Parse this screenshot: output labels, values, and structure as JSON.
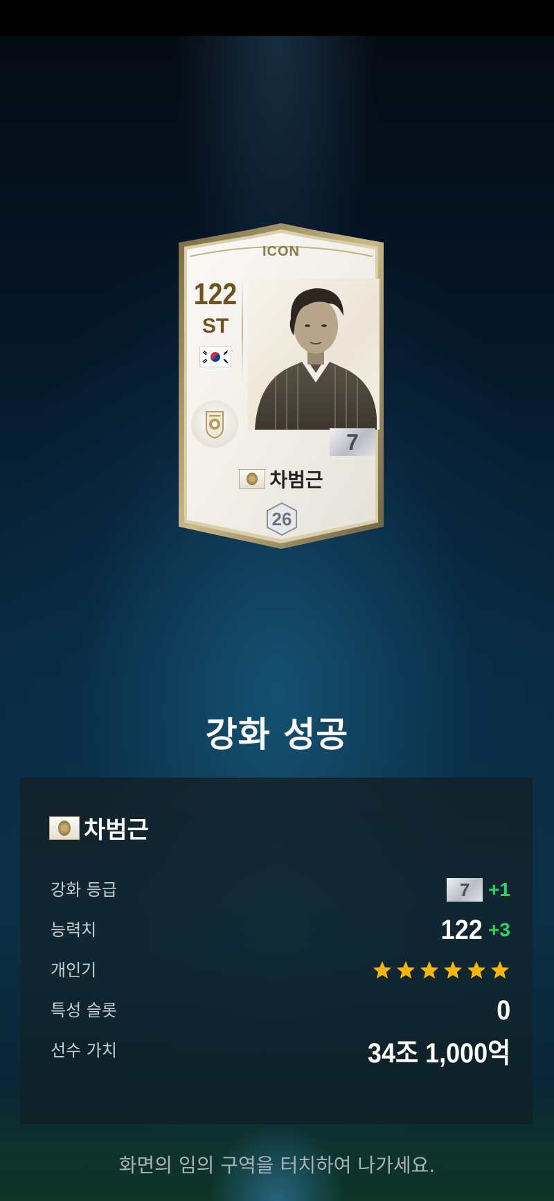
{
  "card": {
    "tier_label": "ICON",
    "overall": "122",
    "position": "ST",
    "grade": "7",
    "name": "차범근",
    "salary": "26"
  },
  "result": {
    "title": "강화 성공"
  },
  "panel": {
    "player_name": "차범근",
    "rows": [
      {
        "label": "강화 등급",
        "grade": "7",
        "delta": "+1"
      },
      {
        "label": "능력치",
        "value": "122",
        "delta": "+3"
      },
      {
        "label": "개인기",
        "stars": 6
      },
      {
        "label": "특성 슬롯",
        "value": "0"
      },
      {
        "label": "선수 가치",
        "value": "34조 1,000억"
      }
    ]
  },
  "exit_hint": "화면의 임의 구역을 터치하여 나가세요.",
  "colors": {
    "accent_green": "#2bd35f",
    "star_gold": "#f5b50a",
    "card_gold": "#6b5420"
  },
  "icons": [
    "korea-flag-icon",
    "icon-badge-icon",
    "star-icon"
  ]
}
